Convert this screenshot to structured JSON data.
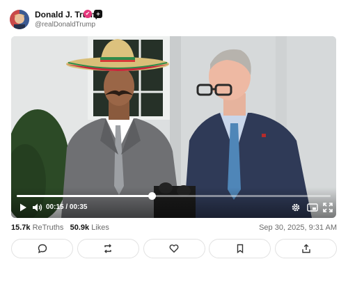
{
  "post": {
    "display_name": "Donald J. Trump",
    "handle": "@realDonaldTrump",
    "badge_text": "+"
  },
  "video": {
    "time": "00:15 / 00:35",
    "progress": 0.43
  },
  "stats": {
    "retruths_count": "15.7k",
    "retruths_label": "ReTruths",
    "likes_count": "50.9k",
    "likes_label": "Likes",
    "timestamp": "Sep 30, 2025, 9:31 AM"
  },
  "actions": [
    {
      "icon": "comment-icon"
    },
    {
      "icon": "retruth-icon"
    },
    {
      "icon": "like-icon"
    },
    {
      "icon": "bookmark-icon"
    },
    {
      "icon": "share-icon"
    }
  ],
  "colors": {
    "verified_badge": "#e5377c",
    "text_secondary": "#6b6b6b"
  }
}
